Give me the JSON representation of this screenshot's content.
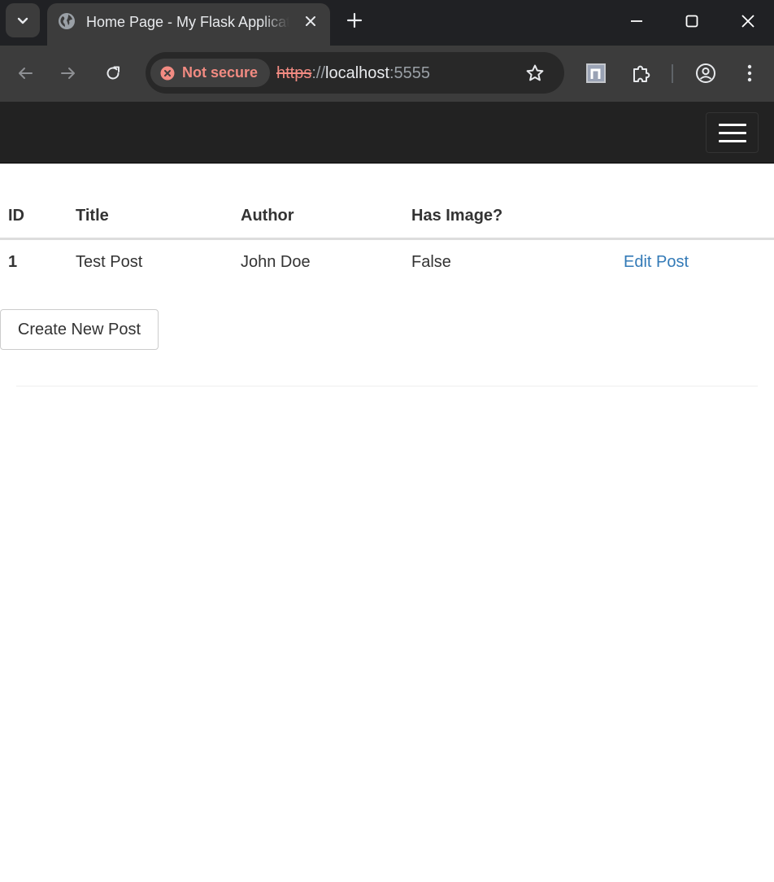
{
  "browser": {
    "tab": {
      "title": "Home Page - My Flask Application",
      "favicon": "globe-icon"
    },
    "omnibox": {
      "security_label": "Not secure",
      "url_scheme": "https",
      "url_sep": "://",
      "url_host": "localhost",
      "url_port": ":5555"
    },
    "icons": {
      "tab_search": "chevron-down-icon",
      "close_tab": "close-icon",
      "new_tab": "plus-icon",
      "minimize": "minimize-icon",
      "maximize": "maximize-icon",
      "close_window": "close-icon",
      "back": "arrow-left-icon",
      "forward": "arrow-right-icon",
      "reload": "reload-icon",
      "bookmark": "star-icon",
      "extension_n": "notion-icon",
      "extensions": "puzzle-icon",
      "profile": "account-circle-icon",
      "menu": "kebab-menu-icon"
    },
    "colors": {
      "not_secure": "#f28b82",
      "frame": "#202124",
      "toolbar": "#3c3c3c"
    }
  },
  "page": {
    "navbar": {
      "toggle_icon": "hamburger-menu-icon",
      "background": "#222222"
    },
    "table": {
      "headers": [
        "ID",
        "Title",
        "Author",
        "Has Image?",
        ""
      ],
      "rows": [
        {
          "id": "1",
          "title": "Test Post",
          "author": "John Doe",
          "has_image": "False",
          "action": "Edit Post"
        }
      ]
    },
    "create_button": "Create New Post",
    "colors": {
      "link": "#337ab7",
      "text": "#333333"
    }
  }
}
